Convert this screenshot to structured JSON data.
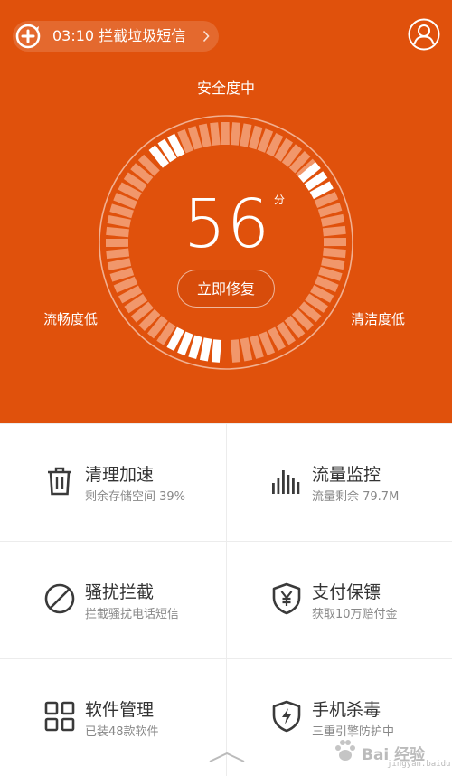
{
  "header": {
    "notice_text": "03:10 拦截垃圾短信"
  },
  "gauge": {
    "status": "安全度中",
    "score": "56",
    "unit": "分",
    "fix_button": "立即修复",
    "left_label": "流畅度低",
    "right_label": "清洁度低",
    "left_level": 0.2,
    "top_level": 0.2,
    "right_level": 0.15
  },
  "features": [
    {
      "title": "清理加速",
      "subtitle": "剩余存储空间 39%",
      "icon": "trash-icon"
    },
    {
      "title": "流量监控",
      "subtitle": "流量剩余 79.7M",
      "icon": "traffic-bars-icon"
    },
    {
      "title": "骚扰拦截",
      "subtitle": "拦截骚扰电话短信",
      "icon": "block-icon"
    },
    {
      "title": "支付保镖",
      "subtitle": "获取10万赔付金",
      "icon": "shield-yen-icon"
    },
    {
      "title": "软件管理",
      "subtitle": "已装48款软件",
      "icon": "grid-apps-icon"
    },
    {
      "title": "手机杀毒",
      "subtitle": "三重引擎防护中",
      "icon": "shield-bolt-icon"
    }
  ],
  "watermark": {
    "text": "Bai 经验",
    "sub": "jingyan.baidu.com"
  },
  "colors": {
    "accent": "#e0510c",
    "text_primary": "#333333",
    "text_secondary": "#888888"
  }
}
